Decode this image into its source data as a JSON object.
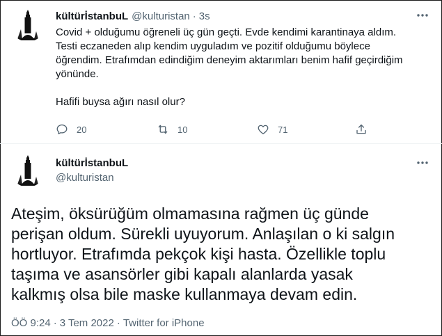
{
  "colors": {
    "text": "#0f1419",
    "muted": "#536471",
    "divider": "#eff3f4",
    "background": "#ffffff"
  },
  "tweet1": {
    "display_name": "kültürİstanbuL",
    "handle": "@kulturistan",
    "separator": "·",
    "time": "3s",
    "avatar_icon": "galata-tower-avatar",
    "more_icon": "more-dots-icon",
    "body_lines": [
      "Covid + olduğumu öğreneli üç gün geçti. Evde kendimi karantinaya aldım.",
      "Testi eczaneden alıp kendim uyguladım ve pozitif olduğumu böylece",
      "öğrendim. Etrafımdan edindiğim deneyim aktarımları benim hafif geçirdiğim",
      "yönünde."
    ],
    "body_last": "Hafifi buysa ağırı nasıl olur?",
    "actions": {
      "reply_icon": "reply-icon",
      "reply_count": "20",
      "retweet_icon": "retweet-icon",
      "retweet_count": "10",
      "like_icon": "heart-icon",
      "like_count": "71",
      "share_icon": "share-icon"
    }
  },
  "tweet2": {
    "display_name": "kültürİstanbuL",
    "handle": "@kulturistan",
    "avatar_icon": "galata-tower-avatar",
    "more_icon": "more-dots-icon",
    "body_lines": [
      "Ateşim, öksürüğüm olmamasına rağmen üç günde",
      "perişan oldum. Sürekli uyuyorum. Anlaşılan o ki salgın",
      "hortluyor. Etrafımda pekçok kişi hasta. Özellikle toplu",
      "taşıma ve asansörler gibi kapalı alanlarda yasak",
      "kalkmış olsa bile maske kullanmaya devam edin."
    ],
    "time": "ÖÖ 9:24",
    "date": "3 Tem 2022",
    "separator": "·",
    "source": "Twitter for iPhone"
  }
}
